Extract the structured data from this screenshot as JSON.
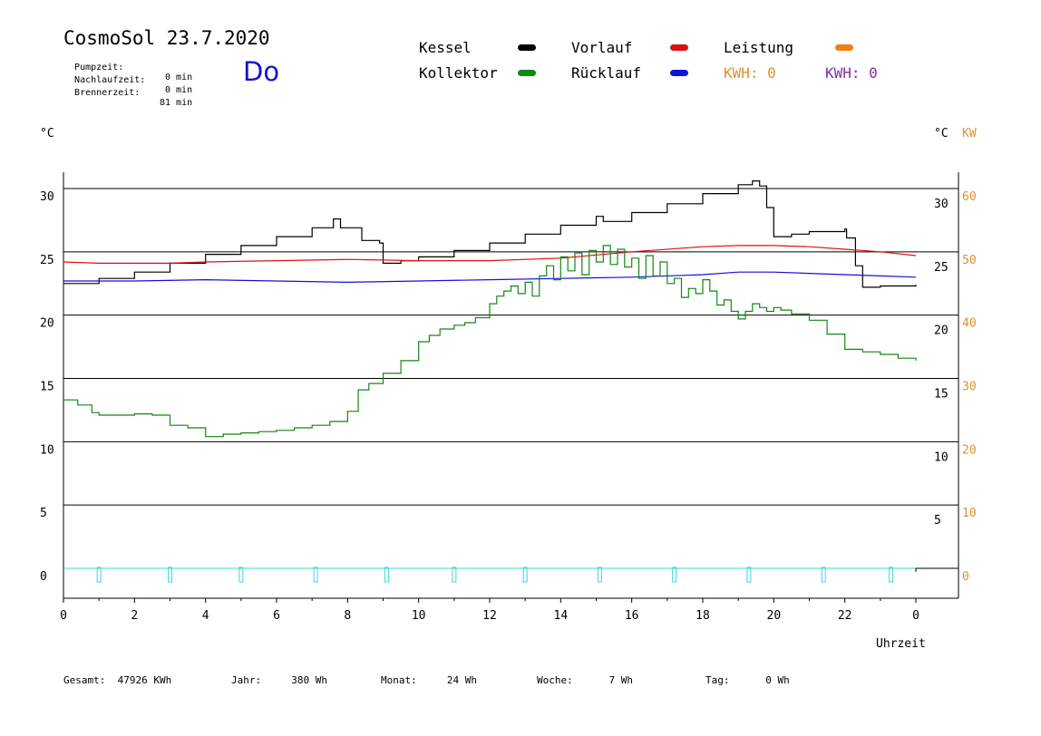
{
  "header": {
    "title": "CosmoSol 23.7.2020",
    "day": "Do",
    "info": [
      {
        "label": "Pumpzeit:",
        "value": "0 min"
      },
      {
        "label": "Nachlaufzeit:",
        "value": "0 min"
      },
      {
        "label": "Brennerzeit:",
        "value": "81 min"
      }
    ]
  },
  "legend": [
    {
      "name": "Kessel",
      "color": "#000000"
    },
    {
      "name": "Kollektor",
      "color": "#118811"
    },
    {
      "name": "Vorlauf",
      "color": "#dd1111"
    },
    {
      "name": "Rücklauf",
      "color": "#1111dd"
    },
    {
      "name": "Leistung",
      "color": "#f08010"
    }
  ],
  "kwh": [
    {
      "text": "KWH: 0",
      "color": "#e09030"
    },
    {
      "text": "KWH: 0",
      "color": "#8030a0"
    }
  ],
  "footer": [
    {
      "label": "Gesamt:",
      "value": "47926 KWh"
    },
    {
      "label": "Jahr:",
      "value": "380 Wh"
    },
    {
      "label": "Monat:",
      "value": "24 Wh"
    },
    {
      "label": "Woche:",
      "value": "7 Wh"
    },
    {
      "label": "Tag:",
      "value": "0 Wh"
    }
  ],
  "chart_data": {
    "type": "line",
    "xlabel": "Uhrzeit",
    "ylabel_left": "°C",
    "ylabel_right": "°C",
    "ylabel_right2": "KW",
    "xlim": [
      0,
      24
    ],
    "ylim": [
      0,
      30
    ],
    "x_ticks": [
      "0",
      "2",
      "4",
      "6",
      "8",
      "10",
      "12",
      "14",
      "16",
      "18",
      "20",
      "22",
      "0"
    ],
    "y_ticks_left": [
      "0",
      "5",
      "10",
      "15",
      "20",
      "25",
      "30"
    ],
    "y_ticks_right": [
      "5",
      "10",
      "15",
      "20",
      "25",
      "30"
    ],
    "y_ticks_right2": [
      "0",
      "10",
      "20",
      "30",
      "40",
      "50",
      "60"
    ],
    "grid": true,
    "series": [
      {
        "name": "Kessel",
        "color": "#000000",
        "x": [
          0,
          1,
          2,
          3,
          4,
          5,
          6,
          7,
          7.6,
          7.8,
          8.1,
          8.4,
          8.8,
          8.9,
          9.0,
          9.5,
          10,
          11,
          12,
          13,
          14,
          15,
          15.2,
          16,
          17,
          18,
          19,
          19.4,
          19.6,
          19.8,
          20.0,
          20.5,
          21,
          22,
          22.05,
          22.3,
          22.5,
          23,
          24
        ],
        "y": [
          22.5,
          22.9,
          23.4,
          24.1,
          24.8,
          25.5,
          26.2,
          26.9,
          27.6,
          26.9,
          26.9,
          25.9,
          25.9,
          25.7,
          24.1,
          24.3,
          24.6,
          25.1,
          25.7,
          26.4,
          27.1,
          27.8,
          27.4,
          28.1,
          28.8,
          29.6,
          30.3,
          30.6,
          30.2,
          28.5,
          26.2,
          26.4,
          26.6,
          26.8,
          26.1,
          23.9,
          22.2,
          22.3,
          22.4
        ]
      },
      {
        "name": "Vorlauf",
        "color": "#dd1111",
        "x": [
          0,
          1,
          2,
          3,
          4,
          6,
          8,
          10,
          12,
          14,
          16,
          18,
          19,
          20,
          21,
          22,
          23,
          24
        ],
        "y": [
          24.2,
          24.1,
          24.1,
          24.1,
          24.2,
          24.3,
          24.4,
          24.3,
          24.3,
          24.5,
          25.0,
          25.4,
          25.5,
          25.5,
          25.4,
          25.2,
          25.0,
          24.7
        ]
      },
      {
        "name": "Rücklauf",
        "color": "#1111dd",
        "x": [
          0,
          2,
          4,
          6,
          8,
          10,
          12,
          14,
          16,
          18,
          19,
          20,
          21,
          22,
          23,
          24
        ],
        "y": [
          22.7,
          22.7,
          22.8,
          22.7,
          22.6,
          22.7,
          22.8,
          22.9,
          23.0,
          23.2,
          23.4,
          23.4,
          23.3,
          23.2,
          23.1,
          23.0
        ]
      },
      {
        "name": "Kollektor",
        "color": "#118811",
        "x": [
          0,
          0.4,
          0.8,
          1,
          1.5,
          2,
          2.5,
          3,
          3.5,
          4,
          4.5,
          5,
          5.5,
          6,
          6.5,
          7,
          7.5,
          8,
          8.3,
          8.6,
          9,
          9.5,
          10,
          10.3,
          10.6,
          11,
          11.3,
          11.6,
          12,
          12.2,
          12.4,
          12.6,
          12.8,
          13,
          13.2,
          13.4,
          13.6,
          13.8,
          14,
          14.2,
          14.4,
          14.6,
          14.8,
          15,
          15.2,
          15.4,
          15.6,
          15.8,
          16,
          16.2,
          16.4,
          16.6,
          16.8,
          17,
          17.2,
          17.4,
          17.6,
          17.8,
          18,
          18.2,
          18.4,
          18.6,
          18.8,
          19,
          19.2,
          19.4,
          19.6,
          19.8,
          20,
          20.2,
          20.5,
          21,
          21.5,
          22,
          22.5,
          23,
          23.5,
          24
        ],
        "y": [
          13.3,
          12.9,
          12.3,
          12.1,
          12.1,
          12.2,
          12.1,
          11.3,
          11.1,
          10.4,
          10.6,
          10.7,
          10.8,
          10.9,
          11.1,
          11.3,
          11.6,
          12.4,
          14.1,
          14.6,
          15.4,
          16.4,
          17.9,
          18.4,
          18.9,
          19.2,
          19.4,
          19.8,
          20.9,
          21.5,
          21.9,
          22.3,
          21.7,
          22.6,
          21.5,
          23.1,
          23.9,
          22.8,
          24.6,
          23.5,
          24.9,
          23.2,
          25.1,
          24.2,
          25.5,
          24.0,
          25.2,
          23.8,
          24.5,
          22.9,
          24.7,
          23.1,
          24.2,
          22.5,
          22.9,
          21.4,
          22.1,
          21.7,
          22.8,
          21.9,
          20.8,
          21.2,
          20.3,
          19.7,
          20.3,
          20.9,
          20.6,
          20.3,
          20.6,
          20.4,
          20.1,
          19.6,
          18.5,
          17.3,
          17.1,
          16.9,
          16.6,
          16.4
        ]
      },
      {
        "name": "Leistung",
        "color": "#40d8d8",
        "x": [
          0,
          1,
          3,
          5,
          7.1,
          9.1,
          11,
          13,
          15.1,
          17.2,
          19.3,
          21.4,
          23.3,
          24
        ],
        "y": [
          0,
          0,
          0,
          0,
          0,
          0,
          0,
          0,
          0,
          0,
          0,
          0,
          0,
          0
        ]
      }
    ]
  }
}
